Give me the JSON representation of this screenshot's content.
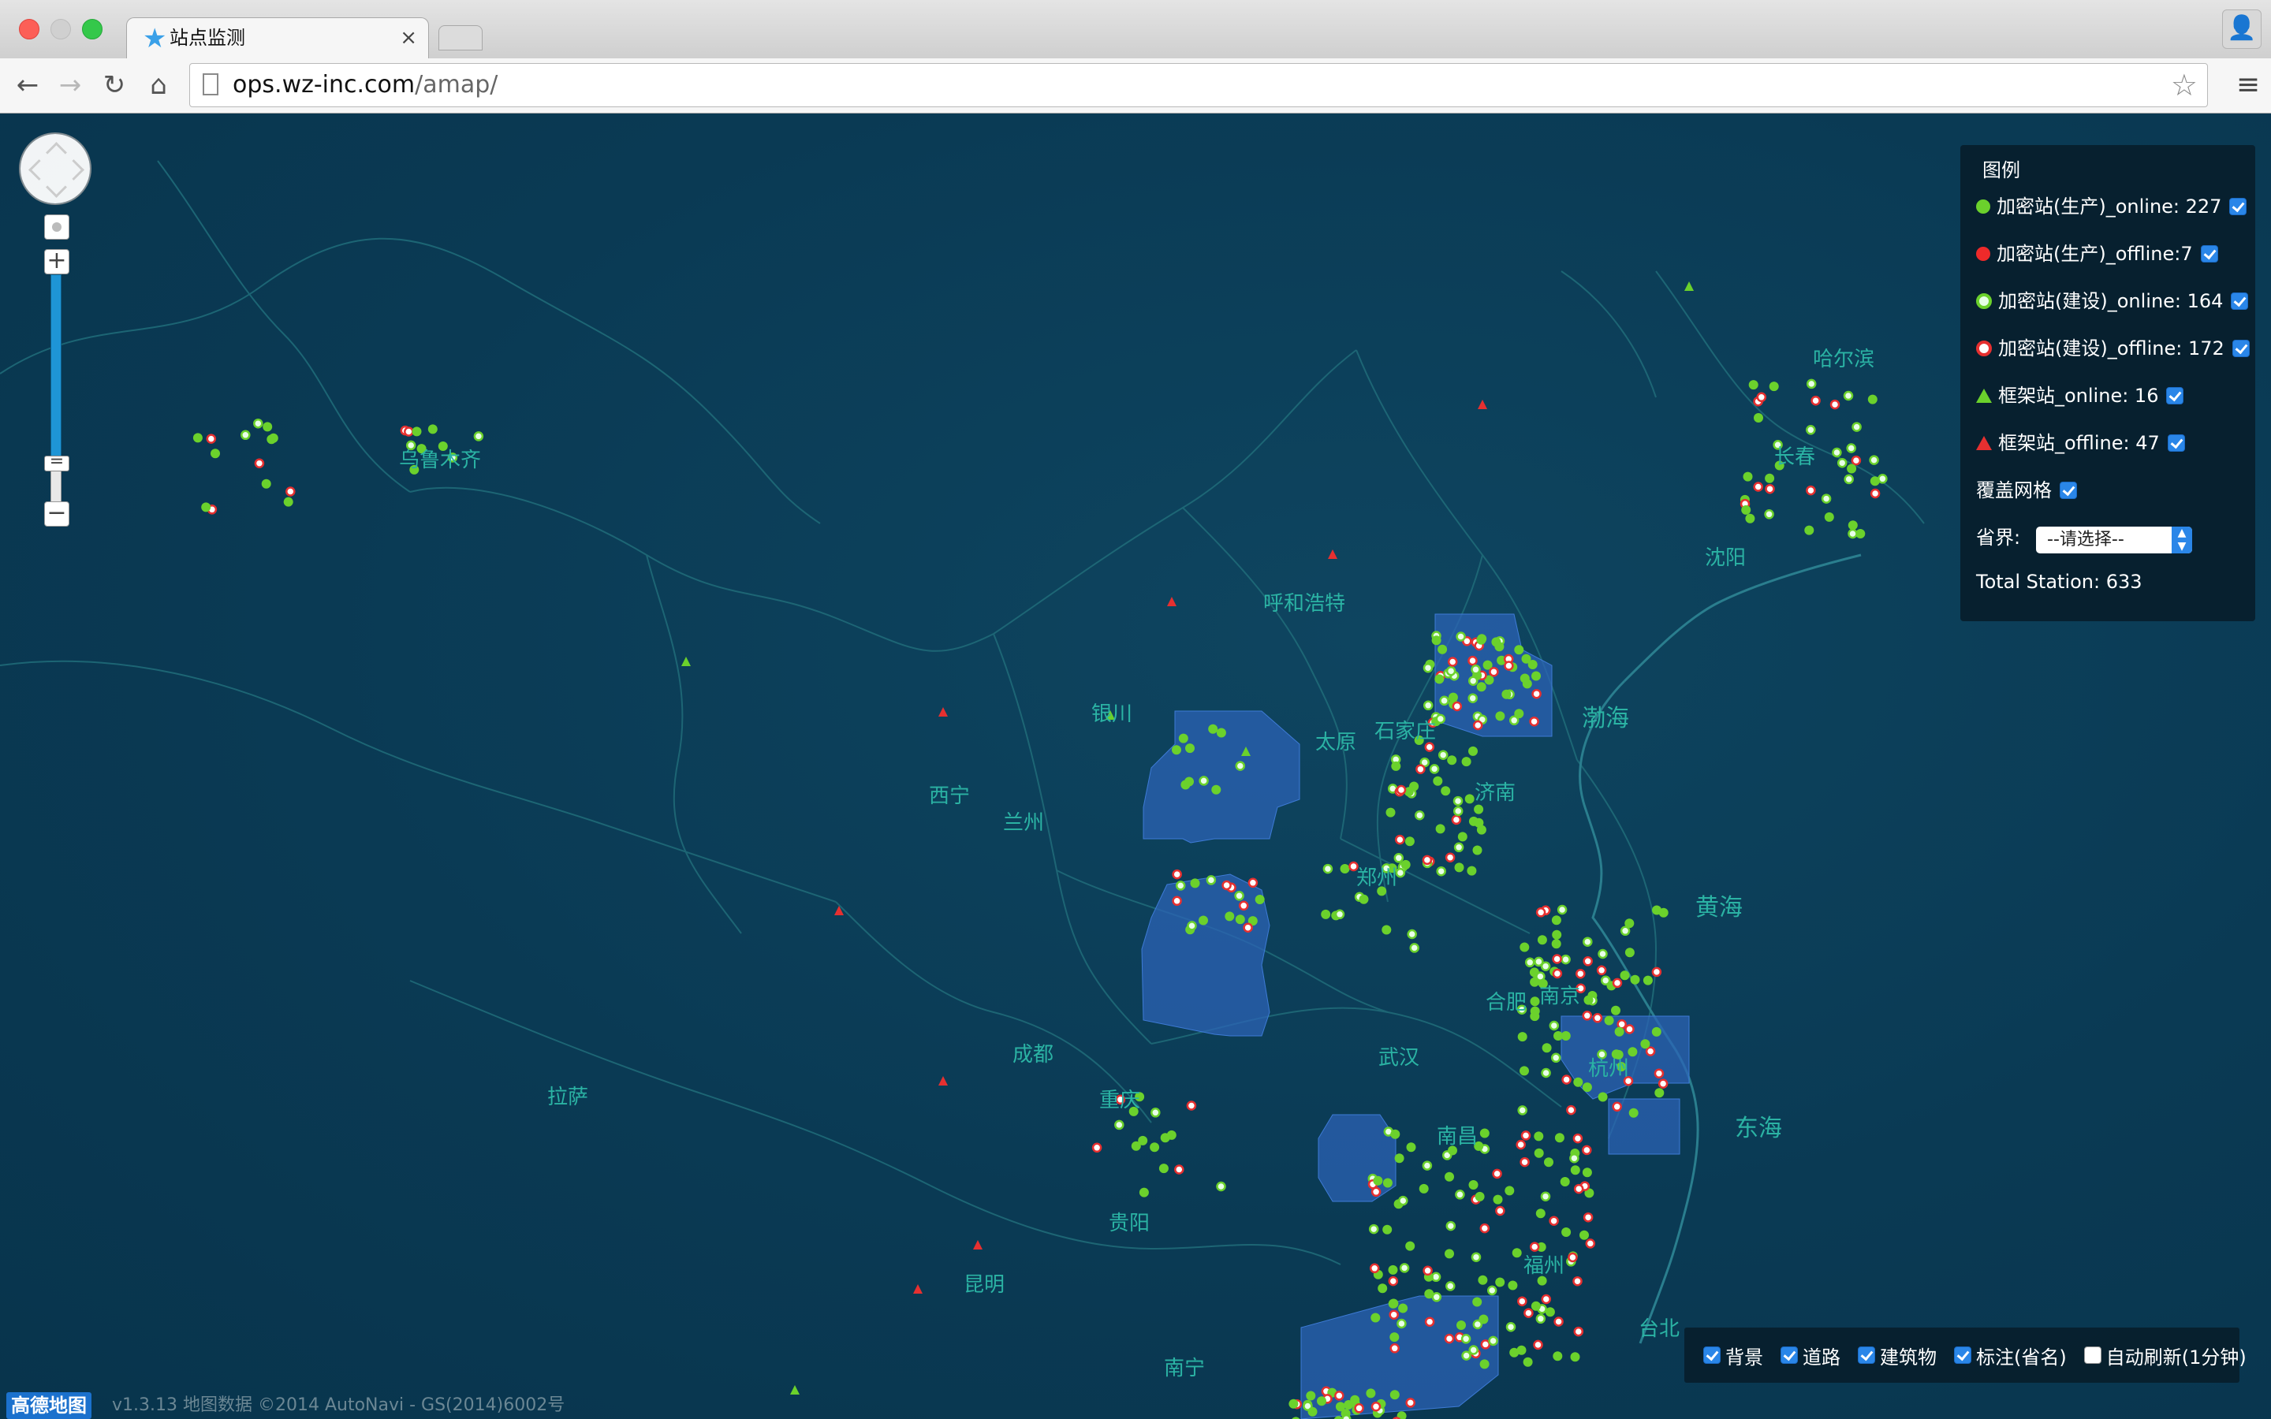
{
  "browser": {
    "tab_title": "站点监测",
    "tab_close": "×",
    "url_host": "ops.wz-inc.com",
    "url_path": "/amap/",
    "icons": {
      "back": "←",
      "forward": "→",
      "reload": "↻",
      "home": "⌂",
      "star": "☆",
      "menu": "≡",
      "profile": "👤",
      "tab": "★"
    }
  },
  "map": {
    "colors": {
      "background": "#0b3a53",
      "label": "#2bb3a4",
      "online": "#6bd12c",
      "offline": "#e63030"
    },
    "controls": {
      "zoom_in": "+",
      "zoom_out": "−",
      "zoom_handle": "="
    },
    "cities": [
      {
        "name": "哈尔滨"
      },
      {
        "name": "长春"
      },
      {
        "name": "沈阳"
      },
      {
        "name": "呼和浩特"
      },
      {
        "name": "银川"
      },
      {
        "name": "太原"
      },
      {
        "name": "石家庄"
      },
      {
        "name": "济南"
      },
      {
        "name": "西宁"
      },
      {
        "name": "兰州"
      },
      {
        "name": "郑州"
      },
      {
        "name": "合肥"
      },
      {
        "name": "南京"
      },
      {
        "name": "杭州"
      },
      {
        "name": "成都"
      },
      {
        "name": "武汉"
      },
      {
        "name": "重庆"
      },
      {
        "name": "南昌"
      },
      {
        "name": "拉萨"
      },
      {
        "name": "贵阳"
      },
      {
        "name": "福州"
      },
      {
        "name": "昆明"
      },
      {
        "name": "南宁"
      },
      {
        "name": "台北"
      },
      {
        "name": "乌鲁木齐"
      }
    ],
    "seas": [
      {
        "name": "渤海"
      },
      {
        "name": "黄海"
      },
      {
        "name": "东海"
      }
    ],
    "copyright_logo": "高德地图",
    "copyright": "v1.3.13 地图数据 ©2014 AutoNavi - GS(2014)6002号"
  },
  "legend": {
    "title": "图例",
    "items": [
      {
        "label": "加密站(生产)_online: 227",
        "symbol": "dot-green",
        "checked": true
      },
      {
        "label": "加密站(生产)_offline:7",
        "symbol": "dot-red",
        "checked": true
      },
      {
        "label": "加密站(建设)_online: 164",
        "symbol": "ring-green",
        "checked": true
      },
      {
        "label": "加密站(建设)_offline: 172",
        "symbol": "ring-red",
        "checked": true
      },
      {
        "label": "框架站_online: 16",
        "symbol": "tri-green",
        "checked": true
      },
      {
        "label": "框架站_offline: 47",
        "symbol": "tri-red",
        "checked": true
      }
    ],
    "grid_label": "覆盖网格",
    "grid_checked": true,
    "province_label": "省界:",
    "province_select": "--请选择--",
    "total": "Total Station: 633"
  },
  "layers": [
    {
      "label": "背景",
      "checked": true
    },
    {
      "label": "道路",
      "checked": true
    },
    {
      "label": "建筑物",
      "checked": true
    },
    {
      "label": "标注(省名)",
      "checked": true
    },
    {
      "label": "自动刷新(1分钟)",
      "checked": false
    }
  ]
}
